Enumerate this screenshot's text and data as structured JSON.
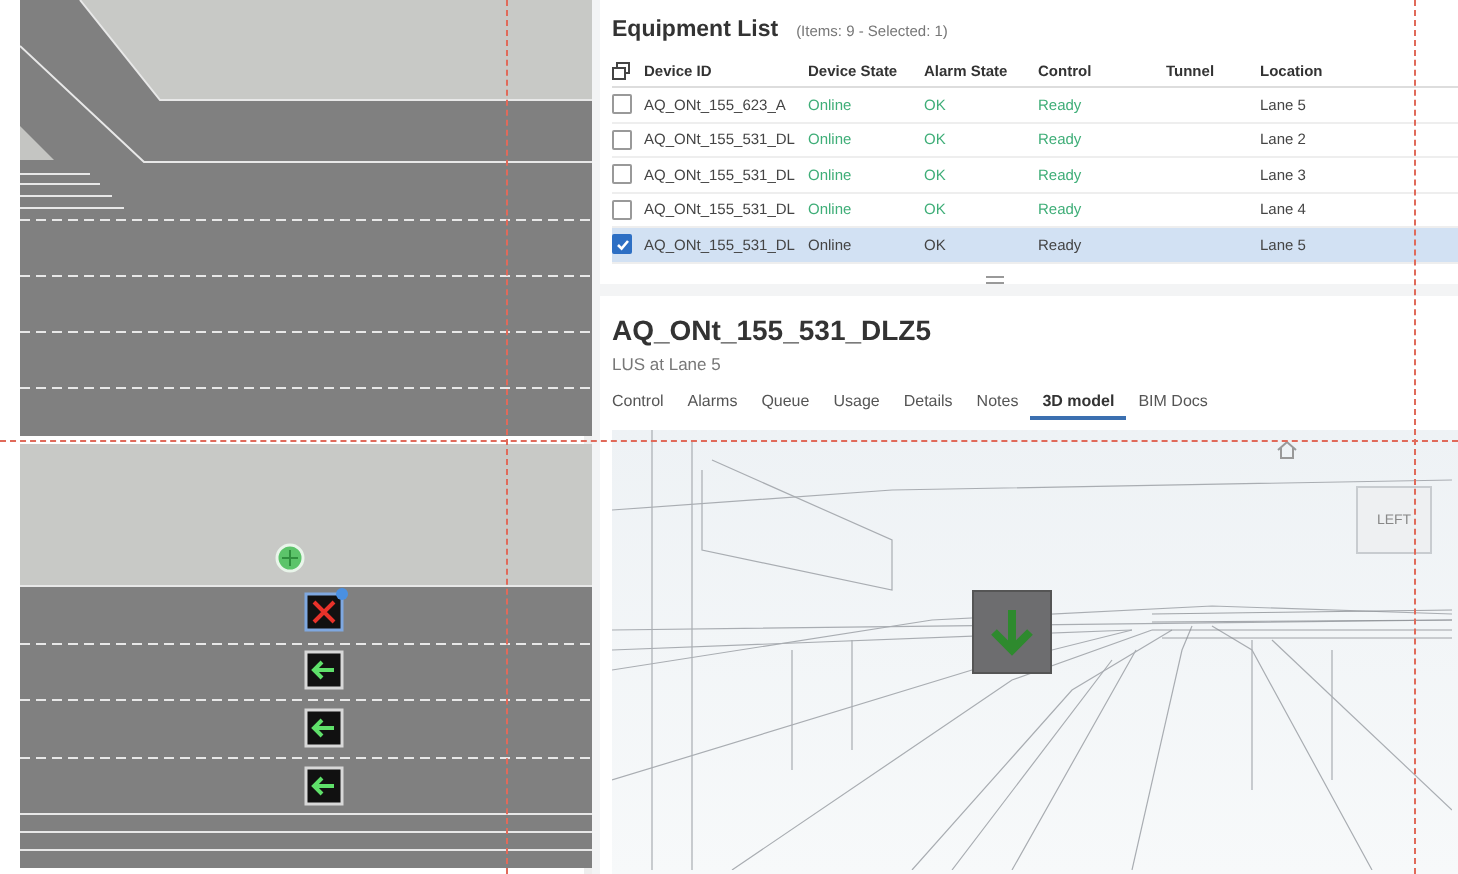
{
  "map": {
    "lane_signals": [
      {
        "kind": "closed",
        "selected": true
      },
      {
        "kind": "left",
        "selected": false
      },
      {
        "kind": "left",
        "selected": false
      },
      {
        "kind": "left",
        "selected": false
      }
    ]
  },
  "equipment_list": {
    "title": "Equipment List",
    "meta": "(Items: 9  -  Selected: 1)",
    "columns": [
      "Device ID",
      "Device State",
      "Alarm State",
      "Control",
      "Tunnel",
      "Location"
    ],
    "rows": [
      {
        "device_id": "AQ_ONt_155_623_A",
        "device_state": "Online",
        "alarm_state": "OK",
        "control": "Ready",
        "location": "Lane 5",
        "checked": false,
        "selected": false
      },
      {
        "device_id": "AQ_ONt_155_531_DL",
        "device_state": "Online",
        "alarm_state": "OK",
        "control": "Ready",
        "location": "Lane 2",
        "checked": false,
        "selected": false
      },
      {
        "device_id": "AQ_ONt_155_531_DL",
        "device_state": "Online",
        "alarm_state": "OK",
        "control": "Ready",
        "location": "Lane 3",
        "checked": false,
        "selected": false
      },
      {
        "device_id": "AQ_ONt_155_531_DL",
        "device_state": "Online",
        "alarm_state": "OK",
        "control": "Ready",
        "location": "Lane 4",
        "checked": false,
        "selected": false
      },
      {
        "device_id": "AQ_ONt_155_531_DL",
        "device_state": "Online",
        "alarm_state": "OK",
        "control": "Ready",
        "location": "Lane 5",
        "checked": true,
        "selected": true
      }
    ]
  },
  "detail": {
    "title": "AQ_ONt_155_531_DLZ5",
    "subtitle": "LUS at Lane 5",
    "tabs": [
      {
        "label": "Control",
        "selected": false
      },
      {
        "label": "Alarms",
        "selected": false
      },
      {
        "label": "Queue",
        "selected": false
      },
      {
        "label": "Usage",
        "selected": false
      },
      {
        "label": "Details",
        "selected": false
      },
      {
        "label": "Notes",
        "selected": false
      },
      {
        "label": "3D model",
        "selected": true
      },
      {
        "label": "BIM Docs",
        "selected": false
      }
    ]
  },
  "viewer": {
    "signal": {
      "kind": "down"
    },
    "viewcube_label": "LEFT"
  }
}
